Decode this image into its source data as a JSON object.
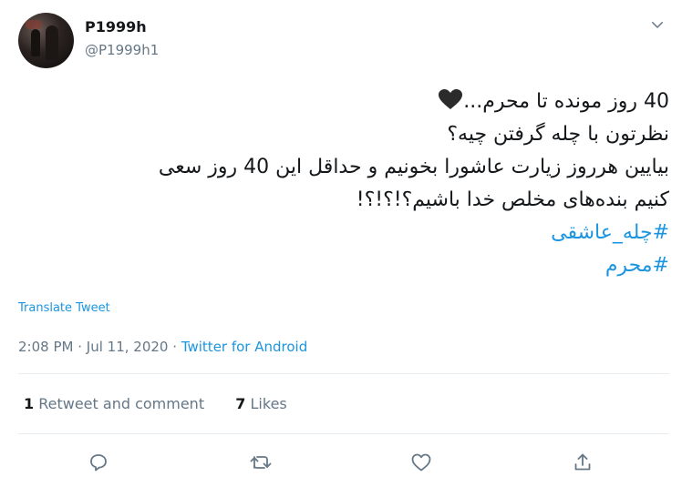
{
  "tweet": {
    "display_name": "P1999h",
    "handle": "@P1999h1",
    "lines": [
      "40 روز مونده تا محرم...",
      "نظرتون با چله گرفتن چیه؟",
      "بیایین هرروز زیارت عاشورا بخونیم و حداقل  این 40 روز سعی",
      "کنیم بنده‌های  مخلص خدا باشیم؟!؟!؟!"
    ],
    "hashtags": [
      "#چله_عاشقی",
      "#محرم"
    ],
    "translate_label": "Translate Tweet",
    "time": "2:08 PM",
    "separator": "·",
    "date": "Jul 11, 2020",
    "source": "Twitter for Android"
  },
  "stats": {
    "retweets_count": "1",
    "retweets_label": "Retweet and comment",
    "likes_count": "7",
    "likes_label": "Likes"
  },
  "colors": {
    "accent": "#1b95e0",
    "secondary_text": "#657786",
    "divider": "#e6ecf0"
  },
  "icons": [
    "avatar",
    "chevron-down-icon",
    "heart-emoji-icon",
    "reply-icon",
    "retweet-icon",
    "like-icon",
    "share-icon"
  ]
}
